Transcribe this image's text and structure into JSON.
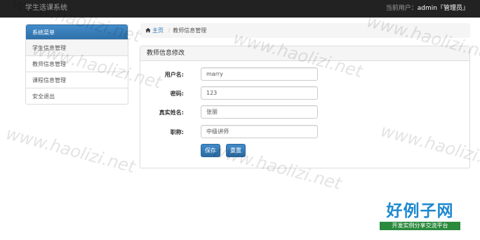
{
  "app": {
    "title": "学生选课系统"
  },
  "header": {
    "user_prefix": "当前用户：",
    "username": "admin",
    "role": "『管理员』"
  },
  "sidebar": {
    "heading": "系统菜单",
    "items": [
      {
        "label": "学生信息管理"
      },
      {
        "label": "教师信息管理"
      },
      {
        "label": "课程信息管理"
      },
      {
        "label": "安全退出"
      }
    ]
  },
  "breadcrumb": {
    "home": "主页",
    "separator": "/",
    "current": "教师信息管理"
  },
  "panel": {
    "title": "教师信息修改"
  },
  "form": {
    "fields": [
      {
        "label": "用户名:",
        "value": "marry"
      },
      {
        "label": "密码:",
        "value": "123"
      },
      {
        "label": "真实姓名:",
        "value": "张丽"
      },
      {
        "label": "职称:",
        "value": "中级讲师"
      }
    ],
    "save_label": "保存",
    "reset_label": "重置"
  },
  "watermark": {
    "text": "www.haolizi.net"
  },
  "logo": {
    "main": "好例子网",
    "sub": "开发实例分享交流平台"
  },
  "colors": {
    "navbar": "#222222",
    "primary": "#428bca",
    "link": "#337ab7",
    "logo_blue": "#1e88d0",
    "logo_green": "#2b8a3e"
  }
}
